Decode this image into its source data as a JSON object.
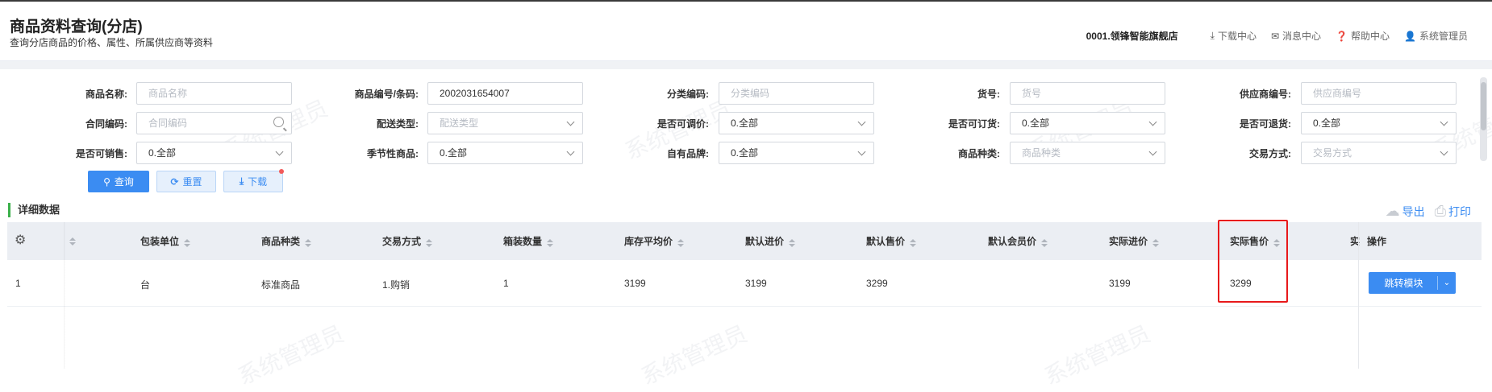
{
  "header": {
    "title": "商品资料查询(分店)",
    "subtitle": "查询分店商品的价格、属性、所属供应商等资料",
    "store": "0001.领锋智能旗舰店",
    "links": [
      {
        "icon": "download-icon",
        "glyph": "⤓",
        "label": "下载中心"
      },
      {
        "icon": "mail-icon",
        "glyph": "✉",
        "label": "消息中心"
      },
      {
        "icon": "help-icon",
        "glyph": "❓",
        "label": "帮助中心"
      },
      {
        "icon": "user-icon",
        "glyph": "👤",
        "label": "系统管理员"
      }
    ]
  },
  "filters": {
    "row1": [
      {
        "label": "商品名称:",
        "value": "",
        "placeholder": "商品名称"
      },
      {
        "label": "商品编号/条码:",
        "value": "2002031654007",
        "placeholder": ""
      },
      {
        "label": "分类编码:",
        "value": "",
        "placeholder": "分类编码"
      },
      {
        "label": "货号:",
        "value": "",
        "placeholder": "货号"
      },
      {
        "label": "供应商编号:",
        "value": "",
        "placeholder": "供应商编号"
      }
    ],
    "row2": [
      {
        "label": "合同编码:",
        "value": "",
        "placeholder": "合同编码"
      },
      {
        "label": "配送类型:",
        "value": "",
        "placeholder": "配送类型"
      },
      {
        "label": "是否可调价:",
        "value": "0.全部",
        "placeholder": ""
      },
      {
        "label": "是否可订货:",
        "value": "0.全部",
        "placeholder": ""
      },
      {
        "label": "是否可退货:",
        "value": "0.全部",
        "placeholder": ""
      }
    ],
    "row3": [
      {
        "label": "是否可销售:",
        "value": "0.全部",
        "placeholder": ""
      },
      {
        "label": "季节性商品:",
        "value": "0.全部",
        "placeholder": ""
      },
      {
        "label": "自有品牌:",
        "value": "0.全部",
        "placeholder": ""
      },
      {
        "label": "商品种类:",
        "value": "",
        "placeholder": "商品种类"
      },
      {
        "label": "交易方式:",
        "value": "",
        "placeholder": "交易方式"
      }
    ]
  },
  "buttons": {
    "query": "查询",
    "reset": "重置",
    "download": "下载"
  },
  "section": {
    "title": "详细数据",
    "export": "导出",
    "print": "打印"
  },
  "table": {
    "columns": [
      "包装单位",
      "商品种类",
      "交易方式",
      "箱装数量",
      "库存平均价",
      "默认进价",
      "默认售价",
      "默认会员价",
      "实际进价",
      "实际售价",
      "实",
      "操作"
    ],
    "rows": [
      {
        "index": "1",
        "cells": [
          "台",
          "标准商品",
          "1.购销",
          "1",
          "3199",
          "3199",
          "3299",
          "",
          "3199",
          "3299"
        ],
        "action": "跳转模块"
      }
    ]
  },
  "watermark": "系统管理员"
}
